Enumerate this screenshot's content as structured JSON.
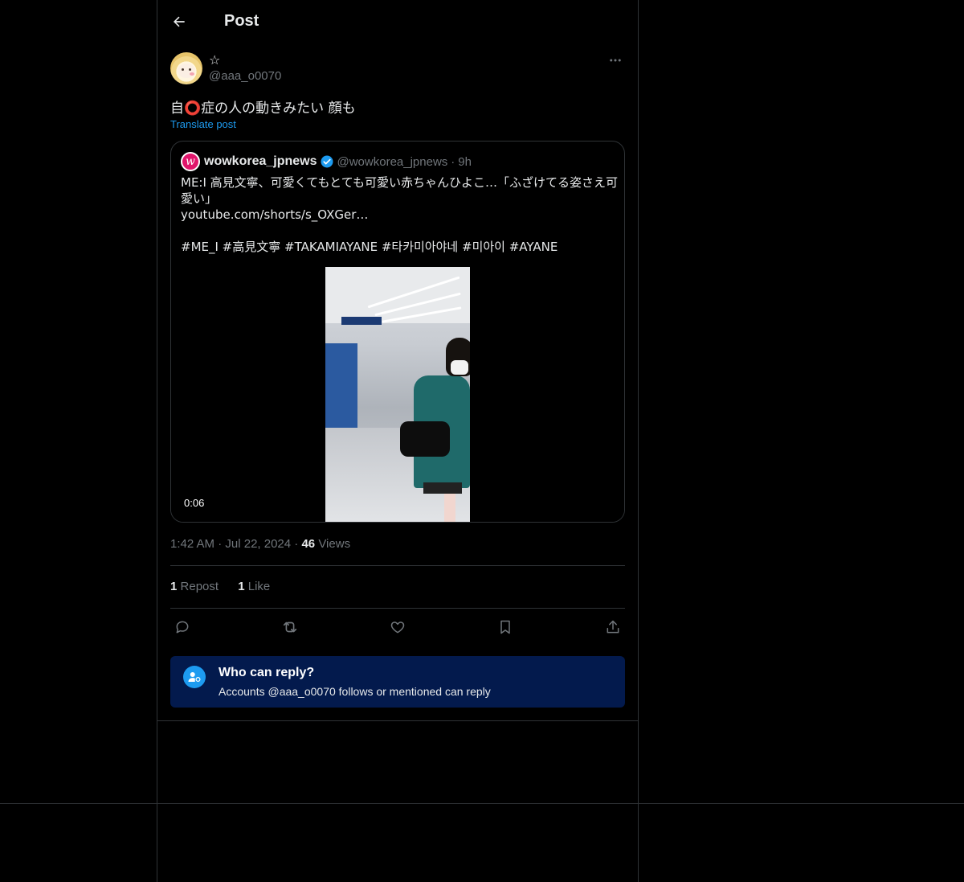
{
  "header": {
    "title": "Post"
  },
  "post": {
    "display_name": "☆",
    "handle": "@aaa_o0070",
    "text": "自⭕症の人の動きみたい 顔も",
    "translate_label": "Translate post",
    "timestamp_time": "1:42 AM",
    "timestamp_date": "Jul 22, 2024",
    "views_count": "46",
    "views_label": "Views",
    "reposts_count": "1",
    "reposts_label": "Repost",
    "likes_count": "1",
    "likes_label": "Like"
  },
  "quote": {
    "avatar_letter": "w",
    "display_name": "wowkorea_jpnews",
    "handle": "@wowkorea_jpnews",
    "time": "9h",
    "lines": [
      "ME:I 高見文寧、可愛くてもとても可愛い赤ちゃんひよこ…「ふざけてる姿さえ可",
      "愛い」",
      "youtube.com/shorts/s_OXGer…",
      "",
      "#ME_I #高見文寧 #TAKAMIAYANE #타카미아야네 #미아이 #AYANE"
    ],
    "video_duration": "0:06"
  },
  "who_can_reply": {
    "title": "Who can reply?",
    "subtitle": "Accounts @aaa_o0070 follows or mentioned can reply"
  },
  "icons": {
    "back": "arrow-left-icon",
    "more": "more-horizontal-icon",
    "verified": "verified-badge-icon",
    "reply": "reply-icon",
    "repost": "repost-icon",
    "like": "heart-icon",
    "bookmark": "bookmark-icon",
    "share": "share-icon",
    "mention": "user-at-icon"
  },
  "colors": {
    "background": "#000000",
    "text": "#e7e9ea",
    "muted": "#71767b",
    "accent": "#1d9bf0",
    "border": "#2f3336",
    "reply_banner": "#031a4d"
  }
}
